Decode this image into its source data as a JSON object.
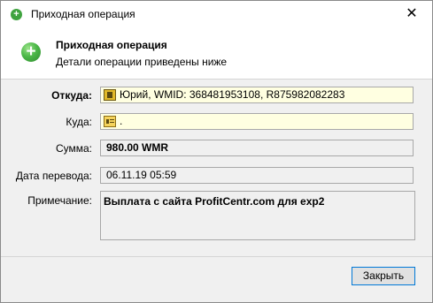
{
  "window": {
    "title": "Приходная операция",
    "close_glyph": "✕"
  },
  "header": {
    "title": "Приходная операция",
    "subtitle": "Детали операции приведены ниже",
    "icon": "plus-circle-icon"
  },
  "form": {
    "from_label": "Откуда:",
    "from_value": "Юрий, WMID: 368481953108, R875982082283",
    "to_label": "Куда:",
    "to_value": ".",
    "amount_label": "Сумма:",
    "amount_value": "980.00 WMR",
    "date_label": "Дата перевода:",
    "date_value": "06.11.19 05:59",
    "note_label": "Примечание:",
    "note_value": "Выплата с сайта ProfitCentr.com для exp2"
  },
  "footer": {
    "close_label": "Закрыть"
  },
  "colors": {
    "field_highlight": "#ffffe1",
    "accent_border": "#0078d7",
    "icon_green": "#3fa33f"
  }
}
